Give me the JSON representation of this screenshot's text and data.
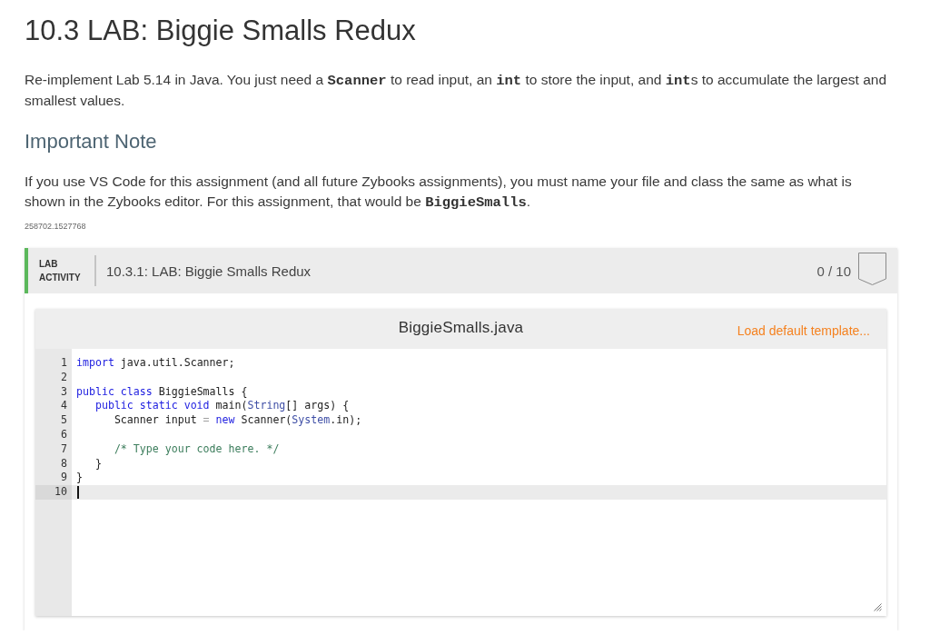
{
  "title": "10.3 LAB: Biggie Smalls Redux",
  "intro": [
    {
      "kind": "text",
      "text": "Re-implement Lab 5.14 in Java. You just need a "
    },
    {
      "kind": "code",
      "text": "Scanner"
    },
    {
      "kind": "text",
      "text": " to read input, an "
    },
    {
      "kind": "code",
      "text": "int"
    },
    {
      "kind": "text",
      "text": " to store the input, and "
    },
    {
      "kind": "code",
      "text": "int"
    },
    {
      "kind": "text",
      "text": "s to accumulate the largest and smallest values."
    }
  ],
  "note": {
    "heading": "Important Note",
    "text": [
      {
        "kind": "text",
        "text": "If you use VS Code for this assignment (and all future Zybooks assignments), you must name your file and class the same as what is shown in the Zybooks editor. For this assignment, that would be "
      },
      {
        "kind": "code",
        "text": "BiggieSmalls"
      },
      {
        "kind": "text",
        "text": "."
      }
    ]
  },
  "content_id": "258702.1527768",
  "lab_activity": {
    "type_label": "LAB ACTIVITY",
    "title": "10.3.1: LAB: Biggie Smalls Redux",
    "score": "0 / 10",
    "editor": {
      "filename": "BiggieSmalls.java",
      "load_template_link": "Load default template...",
      "lines": [
        {
          "number": "1",
          "active": false,
          "tokens": [
            {
              "kind": "keyword",
              "text": "import"
            },
            {
              "kind": "plain",
              "text": " java.util.Scanner;"
            }
          ]
        },
        {
          "number": "2",
          "active": false
        },
        {
          "number": "3",
          "active": false,
          "tokens": [
            {
              "kind": "keyword",
              "text": "public class"
            },
            {
              "kind": "plain",
              "text": " BiggieSmalls {"
            }
          ],
          "children": [
            {
              "number": "4",
              "active": false,
              "tokens": [
                {
                  "kind": "keyword",
                  "text": "public static void"
                },
                {
                  "kind": "plain",
                  "text": " main("
                },
                {
                  "kind": "type",
                  "text": "String"
                },
                {
                  "kind": "plain",
                  "text": "[] args) {"
                }
              ],
              "children": [
                {
                  "number": "5",
                  "active": false,
                  "tokens": [
                    {
                      "kind": "plain",
                      "text": "Scanner input "
                    },
                    {
                      "kind": "operator",
                      "text": "="
                    },
                    {
                      "kind": "keyword",
                      "text": " new"
                    },
                    {
                      "kind": "plain",
                      "text": " Scanner("
                    },
                    {
                      "kind": "type",
                      "text": "System"
                    },
                    {
                      "kind": "plain",
                      "text": ".in);"
                    }
                  ]
                },
                {
                  "number": "6",
                  "active": false
                },
                {
                  "number": "7",
                  "active": false,
                  "tokens": [
                    {
                      "kind": "comment",
                      "text": "/* Type your code here. */"
                    }
                  ]
                }
              ]
            },
            {
              "number": "8",
              "active": false,
              "tokens": [
                {
                  "kind": "plain",
                  "text": "}"
                }
              ]
            }
          ]
        },
        {
          "number": "9",
          "active": false,
          "tokens": [
            {
              "kind": "plain",
              "text": "}"
            }
          ]
        },
        {
          "number": "10",
          "active": true
        }
      ]
    }
  }
}
